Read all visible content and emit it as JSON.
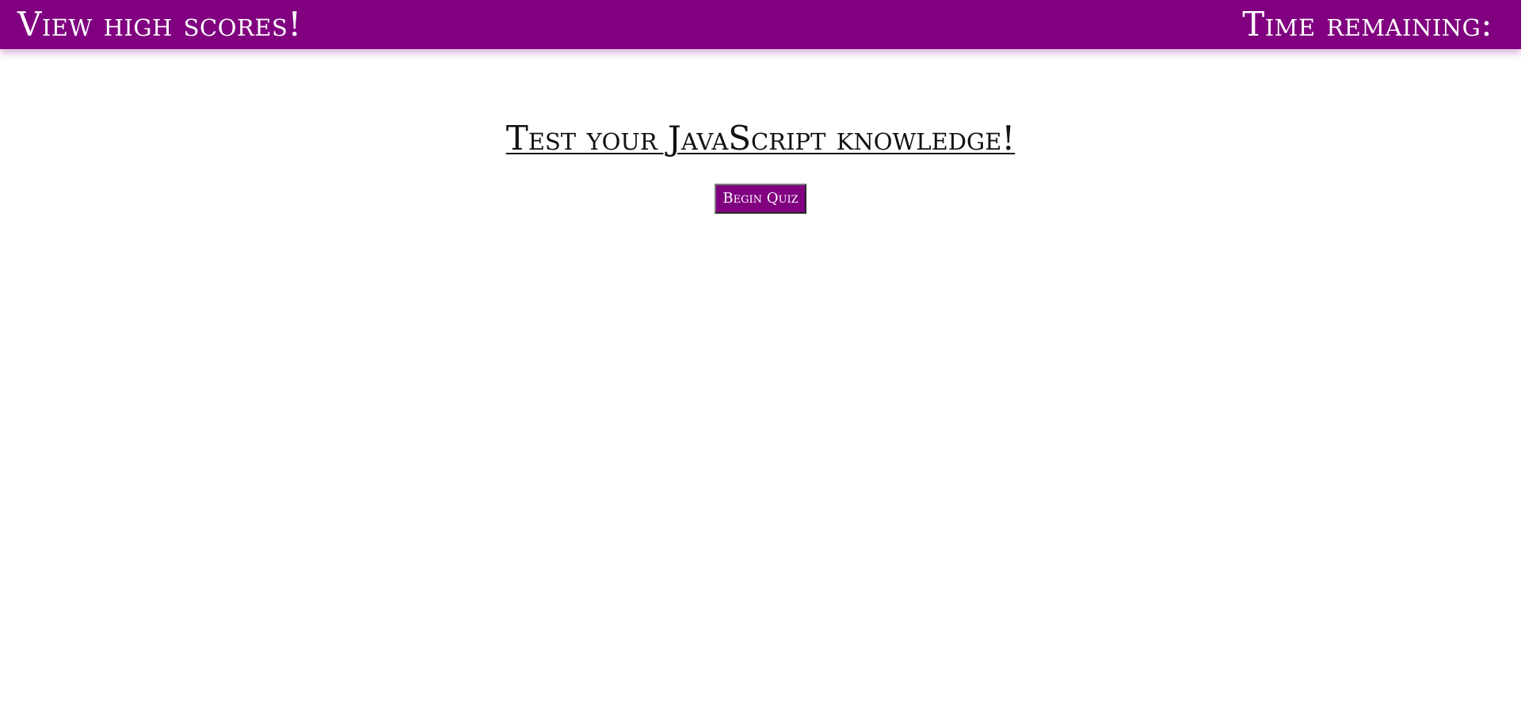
{
  "header": {
    "high_scores_link": "View high scores!",
    "time_remaining_label": "Time remaining:"
  },
  "main": {
    "title": "Test your JavaScript knowledge!",
    "begin_button": "Begin Quiz"
  },
  "colors": {
    "accent": "#800080",
    "text": "#111111",
    "background": "#ffffff"
  }
}
